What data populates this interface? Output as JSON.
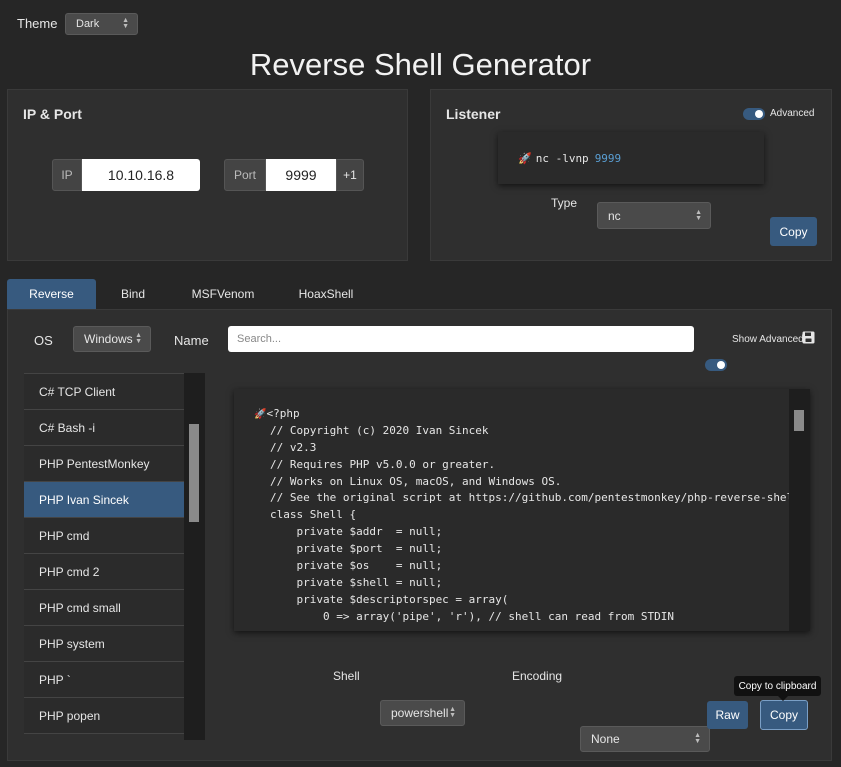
{
  "theme": {
    "label": "Theme",
    "value": "Dark"
  },
  "page_title": "Reverse Shell Generator",
  "ip_port": {
    "title": "IP & Port",
    "ip_label": "IP",
    "ip_value": "10.10.16.8",
    "port_label": "Port",
    "port_value": "9999",
    "increment_label": "+1"
  },
  "listener": {
    "title": "Listener",
    "advanced_label": "Advanced",
    "command_prefix": "nc -lvnp",
    "command_port": "9999",
    "type_label": "Type",
    "type_value": "nc",
    "copy_label": "Copy"
  },
  "tabs": [
    {
      "label": "Reverse",
      "active": true
    },
    {
      "label": "Bind",
      "active": false
    },
    {
      "label": "MSFVenom",
      "active": false
    },
    {
      "label": "HoaxShell",
      "active": false
    }
  ],
  "filters": {
    "os_label": "OS",
    "os_value": "Windows",
    "name_label": "Name",
    "search_placeholder": "Search...",
    "show_advanced_label": "Show Advanced"
  },
  "shell_list": [
    "C# TCP Client",
    "C# Bash -i",
    "PHP PentestMonkey",
    "PHP Ivan Sincek",
    "PHP cmd",
    "PHP cmd 2",
    "PHP cmd small",
    "PHP system",
    "PHP `",
    "PHP popen"
  ],
  "selected_shell": "PHP Ivan Sincek",
  "code_lines": [
    "<?php",
    "// Copyright (c) 2020 Ivan Sincek",
    "// v2.3",
    "// Requires PHP v5.0.0 or greater.",
    "// Works on Linux OS, macOS, and Windows OS.",
    "// See the original script at https://github.com/pentestmonkey/php-reverse-shell.",
    "class Shell {",
    "    private $addr  = null;",
    "    private $port  = null;",
    "    private $os    = null;",
    "    private $shell = null;",
    "    private $descriptorspec = array(",
    "        0 => array('pipe', 'r'), // shell can read from STDIN"
  ],
  "bottom": {
    "shell_label": "Shell",
    "shell_value": "powershell",
    "encoding_label": "Encoding",
    "encoding_value": "None",
    "raw_label": "Raw",
    "copy_label": "Copy",
    "tooltip": "Copy to clipboard"
  },
  "colors": {
    "accent": "#375a7f",
    "background": "#262626",
    "panel": "#2f2f2f",
    "code_port": "#5a9fd4"
  },
  "icons": [
    "rocket-icon",
    "save-icon",
    "caret-updown-icon"
  ]
}
